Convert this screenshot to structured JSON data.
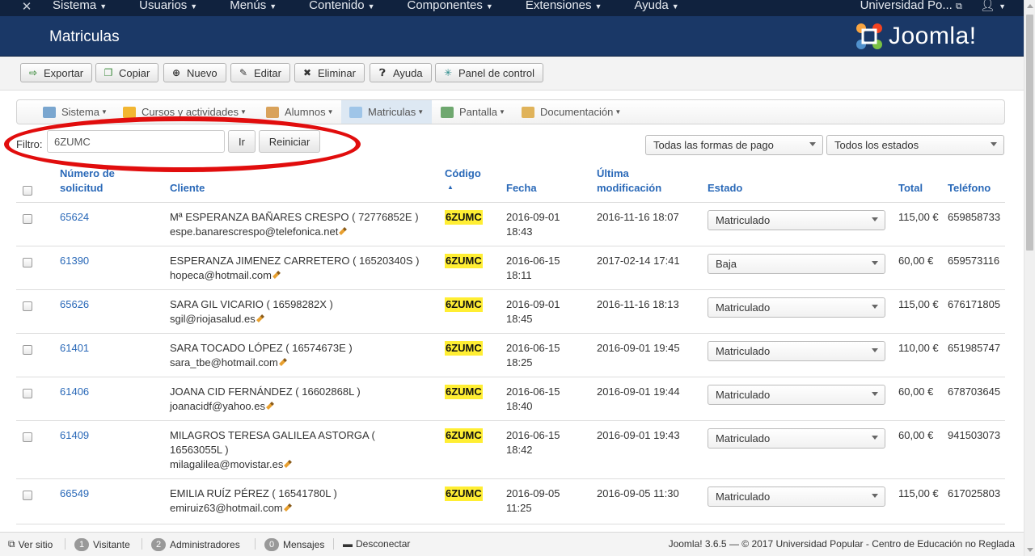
{
  "topnav": {
    "menus": [
      "Sistema",
      "Usuarios",
      "Menús",
      "Contenido",
      "Componentes",
      "Extensiones",
      "Ayuda"
    ],
    "site_name": "Universidad Po...",
    "user_icon": "user-icon"
  },
  "header": {
    "title": "Matriculas",
    "logo_text": "Joomla!"
  },
  "toolbar": {
    "export": "Exportar",
    "copy": "Copiar",
    "new": "Nuevo",
    "edit": "Editar",
    "delete": "Eliminar",
    "help": "Ayuda",
    "control_panel": "Panel de control"
  },
  "subnav": {
    "items": [
      "Sistema",
      "Cursos y actividades",
      "Alumnos",
      "Matriculas",
      "Pantalla",
      "Documentación"
    ],
    "active": "Matriculas"
  },
  "filter": {
    "label": "Filtro:",
    "value": "6ZUMC",
    "go": "Ir",
    "reset": "Reiniciar",
    "payment_select": "Todas las formas de pago",
    "status_select": "Todos los estados"
  },
  "table": {
    "headers": {
      "number": "Número de solicitud",
      "client": "Cliente",
      "code": "Código",
      "date": "Fecha",
      "modified": "Última modificación",
      "status": "Estado",
      "total": "Total",
      "phone": "Teléfono"
    },
    "rows": [
      {
        "number": "65624",
        "client": "Mª ESPERANZA BAÑARES CRESPO ( 72776852E )",
        "email": "espe.banarescrespo@telefonica.net",
        "code": "6ZUMC",
        "date": "2016-09-01 18:43",
        "modified": "2016-11-16 18:07",
        "status": "Matriculado",
        "total": "115,00 €",
        "phone": "659858733"
      },
      {
        "number": "61390",
        "client": "ESPERANZA JIMENEZ CARRETERO ( 16520340S )",
        "email": "hopeca@hotmail.com",
        "code": "6ZUMC",
        "date": "2016-06-15 18:11",
        "modified": "2017-02-14 17:41",
        "status": "Baja",
        "total": "60,00 €",
        "phone": "659573116"
      },
      {
        "number": "65626",
        "client": "SARA GIL VICARIO ( 16598282X )",
        "email": "sgil@riojasalud.es",
        "code": "6ZUMC",
        "date": "2016-09-01 18:45",
        "modified": "2016-11-16 18:13",
        "status": "Matriculado",
        "total": "115,00 €",
        "phone": "676171805"
      },
      {
        "number": "61401",
        "client": "SARA TOCADO LÓPEZ ( 16574673E )",
        "email": "sara_tbe@hotmail.com",
        "code": "6ZUMC",
        "date": "2016-06-15 18:25",
        "modified": "2016-09-01 19:45",
        "status": "Matriculado",
        "total": "110,00 €",
        "phone": "651985747"
      },
      {
        "number": "61406",
        "client": "JOANA CID FERNÁNDEZ ( 16602868L )",
        "email": "joanacidf@yahoo.es",
        "code": "6ZUMC",
        "date": "2016-06-15 18:40",
        "modified": "2016-09-01 19:44",
        "status": "Matriculado",
        "total": "60,00 €",
        "phone": "678703645"
      },
      {
        "number": "61409",
        "client": "MILAGROS TERESA GALILEA ASTORGA ( 16563055L )",
        "email": "milagalilea@movistar.es",
        "code": "6ZUMC",
        "date": "2016-06-15 18:42",
        "modified": "2016-09-01 19:43",
        "status": "Matriculado",
        "total": "60,00 €",
        "phone": "941503073"
      },
      {
        "number": "66549",
        "client": "EMILIA RUÍZ PÉREZ ( 16541780L )",
        "email": "emiruiz63@hotmail.com",
        "code": "6ZUMC",
        "date": "2016-09-05 11:25",
        "modified": "2016-09-05 11:30",
        "status": "Matriculado",
        "total": "115,00 €",
        "phone": "617025803"
      }
    ]
  },
  "statusbar": {
    "view_site": "Ver sitio",
    "visitors_count": "1",
    "visitors": "Visitante",
    "admins_count": "2",
    "admins": "Administradores",
    "messages_count": "0",
    "messages": "Mensajes",
    "logout": "Desconectar",
    "footer": "Joomla! 3.6.5 — © 2017 Universidad Popular - Centro de Educación no Reglada"
  },
  "colors": {
    "topnav_bg": "#10223e",
    "header_bg": "#1a3867",
    "link": "#2a69b8",
    "code_highlight": "#ffee33",
    "annotation_oval": "#e10d0d"
  }
}
